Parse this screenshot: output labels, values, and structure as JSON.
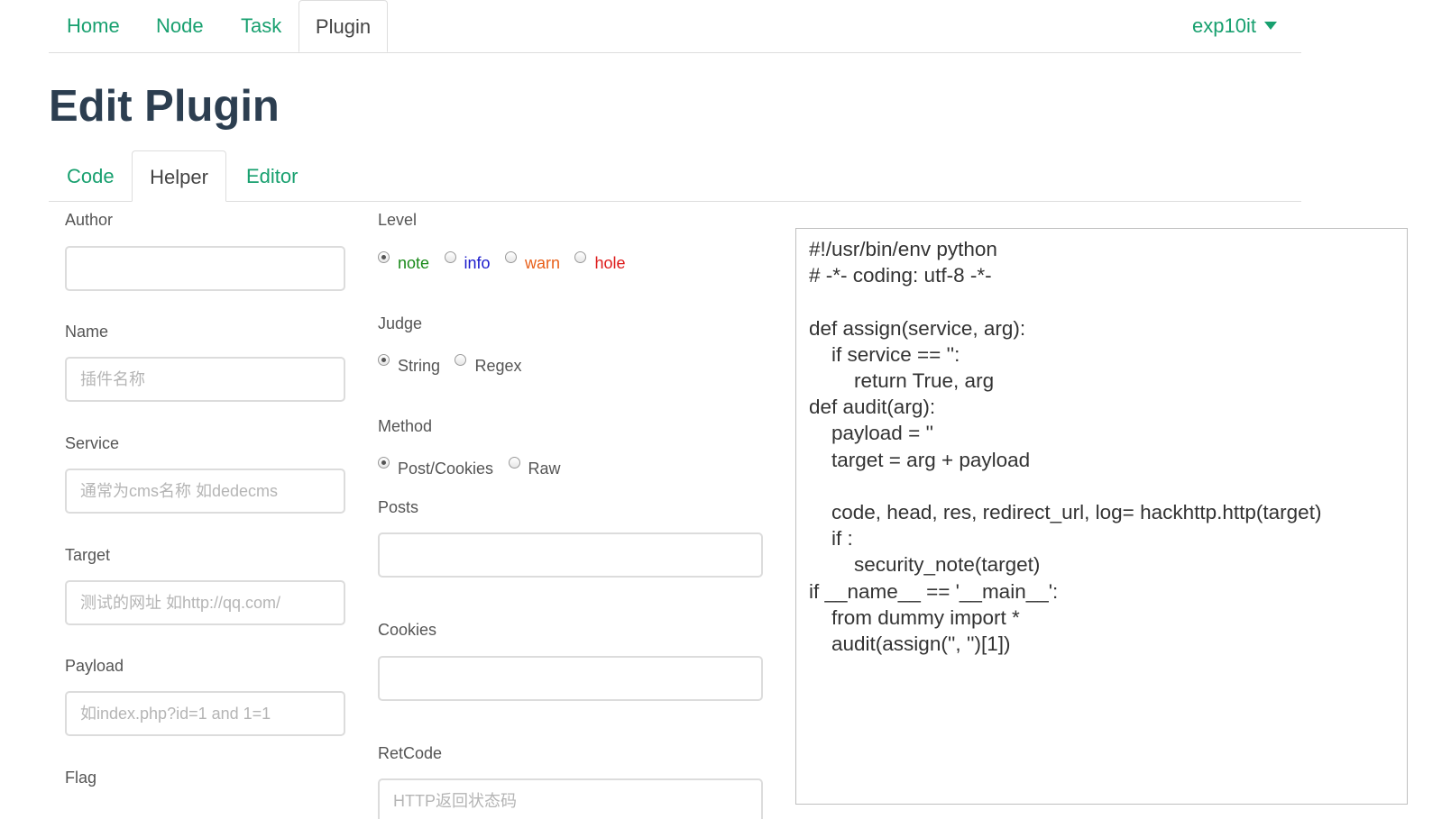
{
  "nav": {
    "tabs": [
      {
        "label": "Home"
      },
      {
        "label": "Node"
      },
      {
        "label": "Task"
      },
      {
        "label": "Plugin"
      }
    ],
    "user": "exp10it"
  },
  "page_title": "Edit Plugin",
  "subtabs": [
    {
      "label": "Code"
    },
    {
      "label": "Helper"
    },
    {
      "label": "Editor"
    }
  ],
  "form": {
    "author": {
      "label": "Author",
      "value": "",
      "placeholder": ""
    },
    "name": {
      "label": "Name",
      "value": "",
      "placeholder": "插件名称"
    },
    "service": {
      "label": "Service",
      "value": "",
      "placeholder": "通常为cms名称 如dedecms"
    },
    "target": {
      "label": "Target",
      "value": "",
      "placeholder": "测试的网址 如http://qq.com/"
    },
    "payload": {
      "label": "Payload",
      "value": "",
      "placeholder": "如index.php?id=1 and 1=1"
    },
    "flag": {
      "label": "Flag"
    },
    "level": {
      "label": "Level",
      "options": [
        {
          "label": "note",
          "color": "#1a8a1a",
          "checked": true
        },
        {
          "label": "info",
          "color": "#1a1acc",
          "checked": false
        },
        {
          "label": "warn",
          "color": "#e8601a",
          "checked": false
        },
        {
          "label": "hole",
          "color": "#dd1a1a",
          "checked": false
        }
      ]
    },
    "judge": {
      "label": "Judge",
      "options": [
        {
          "label": "String",
          "checked": true
        },
        {
          "label": "Regex",
          "checked": false
        }
      ]
    },
    "method": {
      "label": "Method",
      "options": [
        {
          "label": "Post/Cookies",
          "checked": true
        },
        {
          "label": "Raw",
          "checked": false
        }
      ]
    },
    "posts": {
      "label": "Posts",
      "value": "",
      "placeholder": ""
    },
    "cookies": {
      "label": "Cookies",
      "value": "",
      "placeholder": ""
    },
    "retcode": {
      "label": "RetCode",
      "value": "",
      "placeholder": "HTTP返回状态码"
    }
  },
  "code": "#!/usr/bin/env python\n# -*- coding: utf-8 -*-\n\ndef assign(service, arg):\n    if service == '':\n        return True, arg\ndef audit(arg):\n    payload = ''\n    target = arg + payload\n\n    code, head, res, redirect_url, log= hackhttp.http(target)\n    if :\n        security_note(target)\nif __name__ == '__main__':\n    from dummy import *\n    audit(assign('', '')[1])",
  "colors": {
    "accent": "#18a06f",
    "title": "#2c3e50"
  }
}
